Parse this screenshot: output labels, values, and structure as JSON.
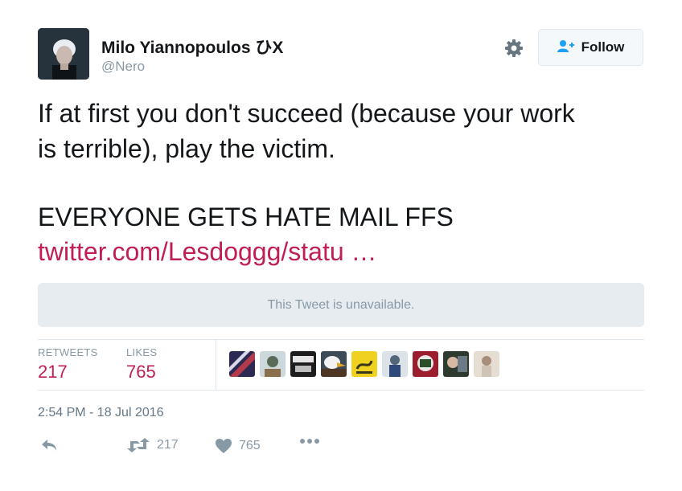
{
  "user": {
    "display_name": "Milo Yiannopoulos ひX",
    "handle": "@Nero"
  },
  "header": {
    "follow_label": "Follow"
  },
  "tweet": {
    "line1": "If at first you don't succeed (because your work",
    "line2": "is terrible), play the victim.",
    "line3": "EVERYONE GETS HATE MAIL FFS",
    "link": "twitter.com/Lesdoggg/statu …"
  },
  "quoted": {
    "message": "This Tweet is unavailable."
  },
  "stats": {
    "retweets_label": "RETWEETS",
    "retweets_count": "217",
    "likes_label": "LIKES",
    "likes_count": "765"
  },
  "timestamp": "2:54 PM - 18 Jul 2016",
  "actions": {
    "retweet_count": "217",
    "like_count": "765"
  },
  "icons": [
    "gear-icon",
    "follow-person-icon",
    "reply-icon",
    "retweet-icon",
    "heart-icon",
    "more-icon"
  ],
  "colors": {
    "link": "#c01e54",
    "muted": "#8899a6",
    "panel": "#e6ecf0"
  }
}
